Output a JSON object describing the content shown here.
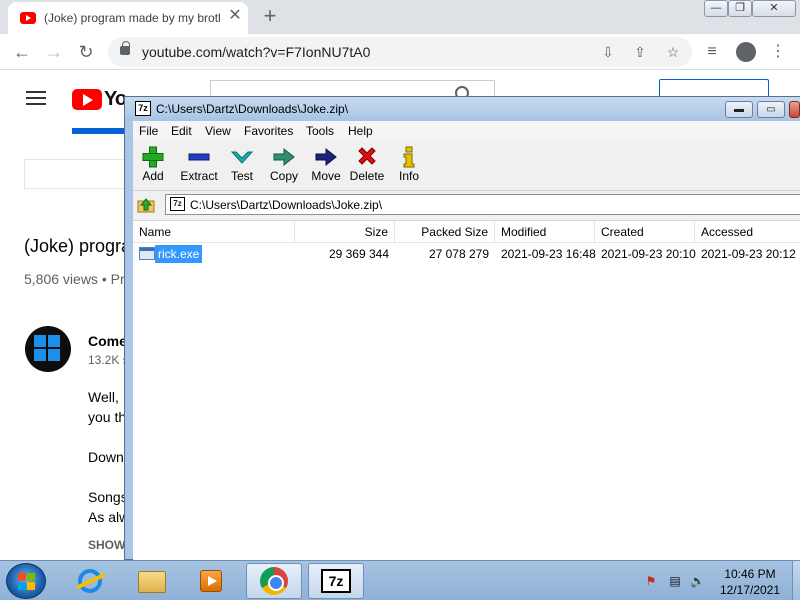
{
  "browser": {
    "tab": {
      "title": "(Joke) program made by my brother",
      "close": "✕"
    },
    "new_tab": "+",
    "window_buttons": {
      "minimize": "—",
      "maximize": "❐",
      "close": "✕"
    },
    "nav": {
      "back": "←",
      "forward": "→",
      "reload": "↻"
    },
    "url": "youtube.com/watch?v=F7IonNU7tA0",
    "toolbar_icons": [
      "install-icon",
      "share-icon",
      "star-icon",
      "playlist-icon",
      "profile-icon",
      "menu-icon"
    ],
    "icon_glyphs": {
      "install": "⇩",
      "share": "⇪",
      "star": "☆",
      "playlist": "≡",
      "menu": "⋮"
    }
  },
  "youtube": {
    "logo_text": "Yo",
    "video_title": "(Joke) progra",
    "views": "5,806 views • Pr",
    "channel_name": "Come",
    "subscribers": "13.2K s",
    "description_lines": [
      "Well, I",
      "you th",
      "Down",
      "Songs",
      "As alw"
    ],
    "show_more": "SHOW"
  },
  "sevenzip": {
    "title": "C:\\Users\\Dartz\\Downloads\\Joke.zip\\",
    "app_icon_text": "7z",
    "caption_buttons": {
      "minimize": "▬",
      "maximize": "▭",
      "close": "✕"
    },
    "menu": [
      "File",
      "Edit",
      "View",
      "Favorites",
      "Tools",
      "Help"
    ],
    "toolbar": [
      {
        "label": "Add",
        "icon": "plus-icon",
        "color": "#22aa22"
      },
      {
        "label": "Extract",
        "icon": "minus-icon",
        "color": "#1f3fbf"
      },
      {
        "label": "Test",
        "icon": "check-icon",
        "color": "#1ab0b0"
      },
      {
        "label": "Copy",
        "icon": "copy-arrow-icon",
        "color": "#2f8f6f"
      },
      {
        "label": "Move",
        "icon": "move-arrow-icon",
        "color": "#1a237e"
      },
      {
        "label": "Delete",
        "icon": "x-icon",
        "color": "#dd1111"
      },
      {
        "label": "Info",
        "icon": "info-icon",
        "color": "#e6c200"
      }
    ],
    "path": "C:\\Users\\Dartz\\Downloads\\Joke.zip\\",
    "columns": [
      "Name",
      "Size",
      "Packed Size",
      "Modified",
      "Created",
      "Accessed"
    ],
    "rows": [
      {
        "name": "rick.exe",
        "size": "29 369 344",
        "packed_size": "27 078 279",
        "modified": "2021-09-23 16:48",
        "created": "2021-09-23 20:10",
        "accessed": "2021-09-23 20:12"
      }
    ]
  },
  "taskbar": {
    "apps": [
      "internet-explorer-icon",
      "windows-explorer-icon",
      "media-player-icon",
      "chrome-icon",
      "7zip-icon"
    ],
    "sz_icon_text": "7z",
    "tray_icons": [
      "action-center-flag-icon",
      "network-icon",
      "volume-icon"
    ],
    "tray_glyphs": {
      "flag": "⚑",
      "network": "▤",
      "volume": "🔈"
    },
    "time": "10:46 PM",
    "date": "12/17/2021"
  }
}
